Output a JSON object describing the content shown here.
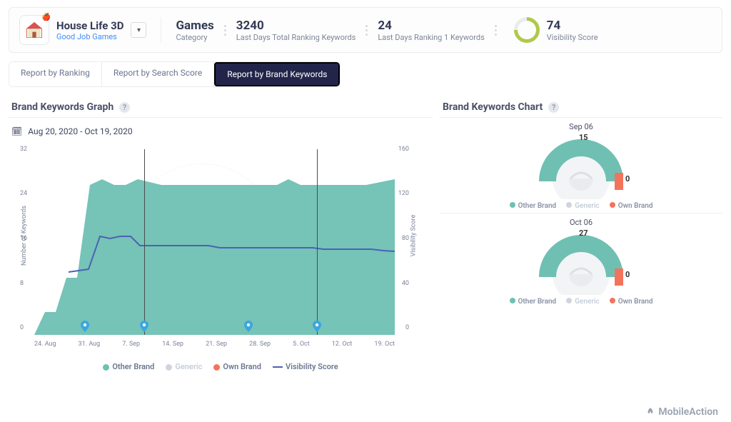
{
  "app": {
    "name": "House Life 3D",
    "developer": "Good Job Games"
  },
  "stats": {
    "category": {
      "value": "Games",
      "label": "Category"
    },
    "total": {
      "value": "3240",
      "label": "Last Days Total Ranking Keywords"
    },
    "rank1": {
      "value": "24",
      "label": "Last Days Ranking 1 Keywords"
    },
    "visibility": {
      "value": "74",
      "label": "Visibility Score"
    }
  },
  "tabs": {
    "ranking": "Report by Ranking",
    "search": "Report by Search Score",
    "brand": "Report by Brand Keywords"
  },
  "left": {
    "title": "Brand Keywords Graph",
    "date_range": "Aug 20, 2020 - Oct 19, 2020",
    "ylabel_left": "Number of Keywords",
    "ylabel_right": "Visibility Score"
  },
  "right": {
    "title": "Brand Keywords Chart"
  },
  "chart_data": {
    "type": "area+line",
    "x": [
      "24. Aug",
      "31. Aug",
      "7. Sep",
      "14. Sep",
      "21. Sep",
      "28. Sep",
      "5. Oct",
      "12. Oct",
      "19. Oct"
    ],
    "y_left_ticks": [
      0,
      8,
      16,
      24,
      32
    ],
    "y_right_ticks": [
      0,
      40,
      80,
      120,
      160
    ],
    "series": [
      {
        "name": "Other Brand",
        "axis": "left",
        "type": "area",
        "color": "#6fc0b3",
        "values": [
          0,
          4,
          10,
          27,
          28,
          27,
          27,
          28,
          27,
          27,
          27,
          27,
          27,
          27,
          27,
          27,
          27,
          27,
          27,
          27,
          27,
          27,
          27,
          28,
          27,
          27,
          27,
          27,
          27,
          27,
          27,
          28
        ]
      },
      {
        "name": "Generic",
        "axis": "left",
        "type": "area",
        "color": "#cfd5df",
        "values": [
          0,
          0,
          0,
          0,
          0,
          0,
          0,
          0,
          0,
          0,
          0,
          0,
          0,
          0,
          0,
          0,
          0,
          0,
          0,
          0,
          0,
          0,
          0,
          0,
          0,
          0,
          0,
          0,
          0,
          0,
          0,
          0
        ]
      },
      {
        "name": "Own Brand",
        "axis": "left",
        "type": "area",
        "color": "#f4745b",
        "values": [
          0,
          0,
          0,
          0,
          0,
          0,
          0,
          0,
          0,
          0,
          0,
          0,
          0,
          0,
          0,
          0,
          0,
          0,
          0,
          0,
          0,
          0,
          0,
          0,
          0,
          0,
          0,
          0,
          0,
          0,
          0,
          0
        ]
      },
      {
        "name": "Visibility Score",
        "axis": "right",
        "type": "line",
        "color": "#4a62b3",
        "values": [
          null,
          null,
          null,
          55,
          56,
          57,
          86,
          84,
          86,
          86,
          78,
          78,
          78,
          78,
          78,
          78,
          78,
          78,
          77,
          77,
          77,
          77,
          77,
          77,
          77,
          77,
          77,
          76,
          76,
          76,
          76,
          75
        ]
      }
    ],
    "markers_x": [
      "31. Aug",
      "7. Sep",
      "21. Sep",
      "5. Oct"
    ],
    "verticals_x": [
      "7. Sep",
      "5. Oct"
    ]
  },
  "donuts": [
    {
      "title": "Sep 06",
      "other": 15,
      "own": 0
    },
    {
      "title": "Oct 06",
      "other": 27,
      "own": 0
    }
  ],
  "legend_labels": {
    "other": "Other Brand",
    "generic": "Generic",
    "own": "Own Brand",
    "vis": "Visibility Score"
  },
  "colors": {
    "other": "#6fc0b3",
    "generic": "#cfd5df",
    "own": "#f4745b",
    "vis": "#4a62b3",
    "accent": "#22244a"
  },
  "footer": {
    "brand": "MobileAction"
  }
}
